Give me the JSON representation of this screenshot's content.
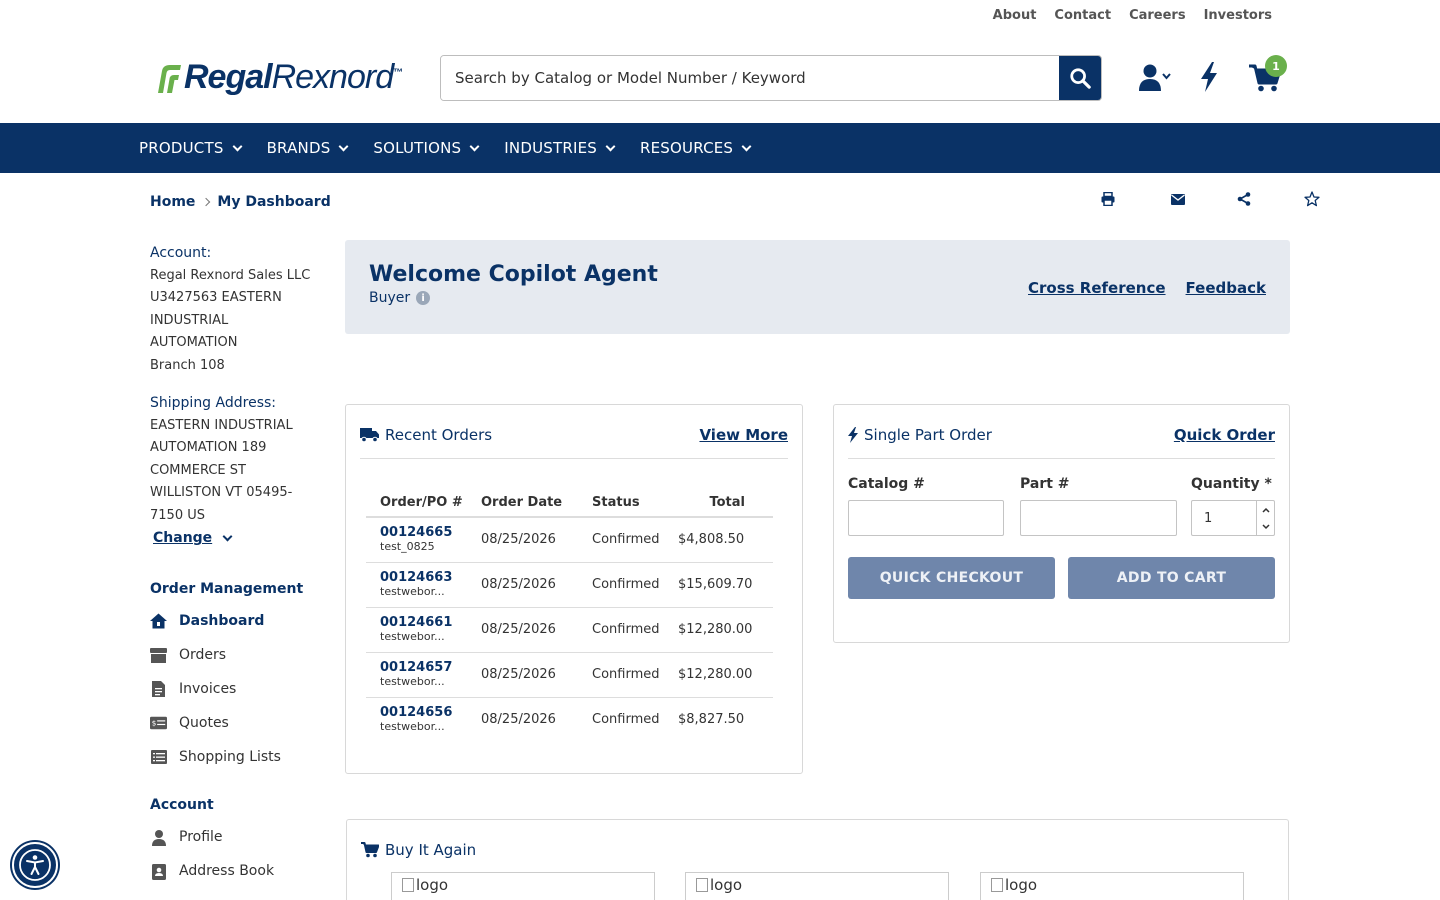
{
  "util_links": [
    "About",
    "Contact",
    "Careers",
    "Investors"
  ],
  "brand": {
    "name_bold": "Regal",
    "name_light": "Rexnord",
    "tm": "™"
  },
  "search": {
    "placeholder": "Search by Catalog or Model Number / Keyword"
  },
  "cart": {
    "count": "1"
  },
  "nav": [
    "PRODUCTS",
    "BRANDS",
    "SOLUTIONS",
    "INDUSTRIES",
    "RESOURCES"
  ],
  "breadcrumb": {
    "home": "Home",
    "current": "My Dashboard"
  },
  "sidebar": {
    "account_label": "Account:",
    "account_lines": [
      "Regal Rexnord Sales LLC",
      "U3427563 EASTERN",
      "INDUSTRIAL",
      "AUTOMATION",
      "Branch 108"
    ],
    "shipping_label": "Shipping Address:",
    "shipping_lines": [
      "EASTERN INDUSTRIAL",
      "AUTOMATION 189",
      "COMMERCE ST",
      "WILLISTON VT 05495-",
      "7150 US"
    ],
    "change_label": "Change",
    "order_mgmt_title": "Order Management",
    "order_mgmt_items": [
      "Dashboard",
      "Orders",
      "Invoices",
      "Quotes",
      "Shopping Lists"
    ],
    "account_title": "Account",
    "account_items": [
      "Profile",
      "Address Book"
    ]
  },
  "welcome": {
    "title": "Welcome Copilot Agent",
    "role": "Buyer",
    "info_glyph": "i",
    "links": [
      "Cross Reference",
      "Feedback"
    ]
  },
  "recent_orders": {
    "title": "Recent Orders",
    "link": "View More",
    "columns": [
      "Order/PO #",
      "Order Date",
      "Status",
      "Total"
    ],
    "rows": [
      {
        "order": "00124665",
        "po": "test_0825",
        "date": "08/25/2026",
        "status": "Confirmed",
        "total": "$4,808.50"
      },
      {
        "order": "00124663",
        "po": "testwebor...",
        "date": "08/25/2026",
        "status": "Confirmed",
        "total": "$15,609.70"
      },
      {
        "order": "00124661",
        "po": "testwebor...",
        "date": "08/25/2026",
        "status": "Confirmed",
        "total": "$12,280.00"
      },
      {
        "order": "00124657",
        "po": "testwebor...",
        "date": "08/25/2026",
        "status": "Confirmed",
        "total": "$12,280.00"
      },
      {
        "order": "00124656",
        "po": "testwebor...",
        "date": "08/25/2026",
        "status": "Confirmed",
        "total": "$8,827.50"
      }
    ]
  },
  "single_part": {
    "title": "Single Part Order",
    "link": "Quick Order",
    "catalog_label": "Catalog #",
    "part_label": "Part #",
    "qty_label": "Quantity *",
    "qty_value": "1",
    "checkout_label": "QUICK CHECKOUT",
    "add_label": "ADD TO CART"
  },
  "buy_again": {
    "title": "Buy It Again",
    "logos": [
      "logo",
      "logo",
      "logo"
    ]
  },
  "colors": {
    "brand_navy": "#0a3266",
    "brand_green": "#6ab04c",
    "button_disabled": "#6f86ab",
    "panel": "#e6eaf0"
  },
  "icons": [
    "search-icon",
    "user-icon",
    "bolt-icon",
    "cart-icon",
    "print-icon",
    "email-icon",
    "share-icon",
    "star-icon",
    "truck-icon",
    "accessibility-icon"
  ]
}
